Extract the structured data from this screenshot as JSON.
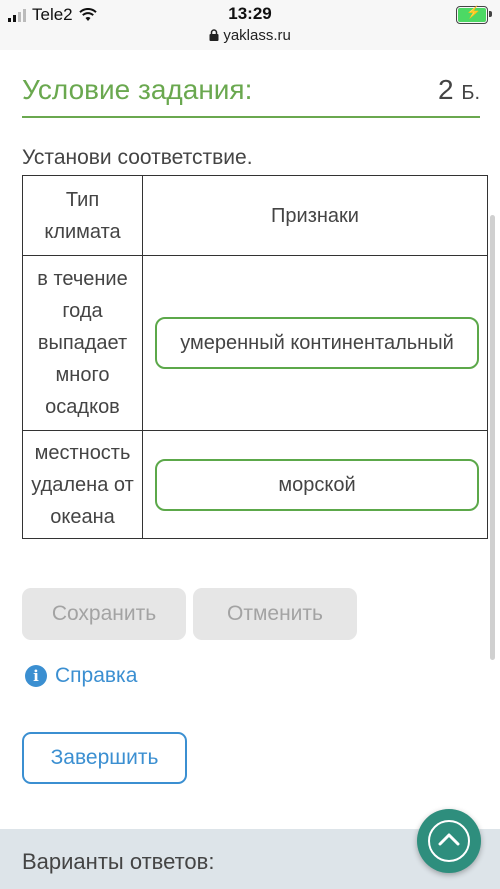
{
  "status_bar": {
    "carrier": "Tele2",
    "time": "13:29",
    "url": "yaklass.ru"
  },
  "task": {
    "title": "Условие задания:",
    "points": "2",
    "points_unit": "Б.",
    "instruction": "Установи соответствие."
  },
  "table": {
    "headers": [
      "Тип климата",
      "Признаки"
    ],
    "rows": [
      {
        "label": "в течение года выпадает много осадков",
        "answer": "умеренный континентальный"
      },
      {
        "label": "местность удалена от океана",
        "answer": "морской"
      }
    ]
  },
  "buttons": {
    "save": "Сохранить",
    "cancel": "Отменить",
    "help": "Справка",
    "finish": "Завершить"
  },
  "footer": {
    "answers_label": "Варианты ответов:"
  },
  "colors": {
    "accent_green": "#6aa84f",
    "link_blue": "#3b8fd1",
    "fab_teal": "#2e8e7d"
  },
  "icons": [
    "wifi-icon",
    "lock-icon",
    "battery-icon",
    "info-icon",
    "chevron-up-icon"
  ]
}
